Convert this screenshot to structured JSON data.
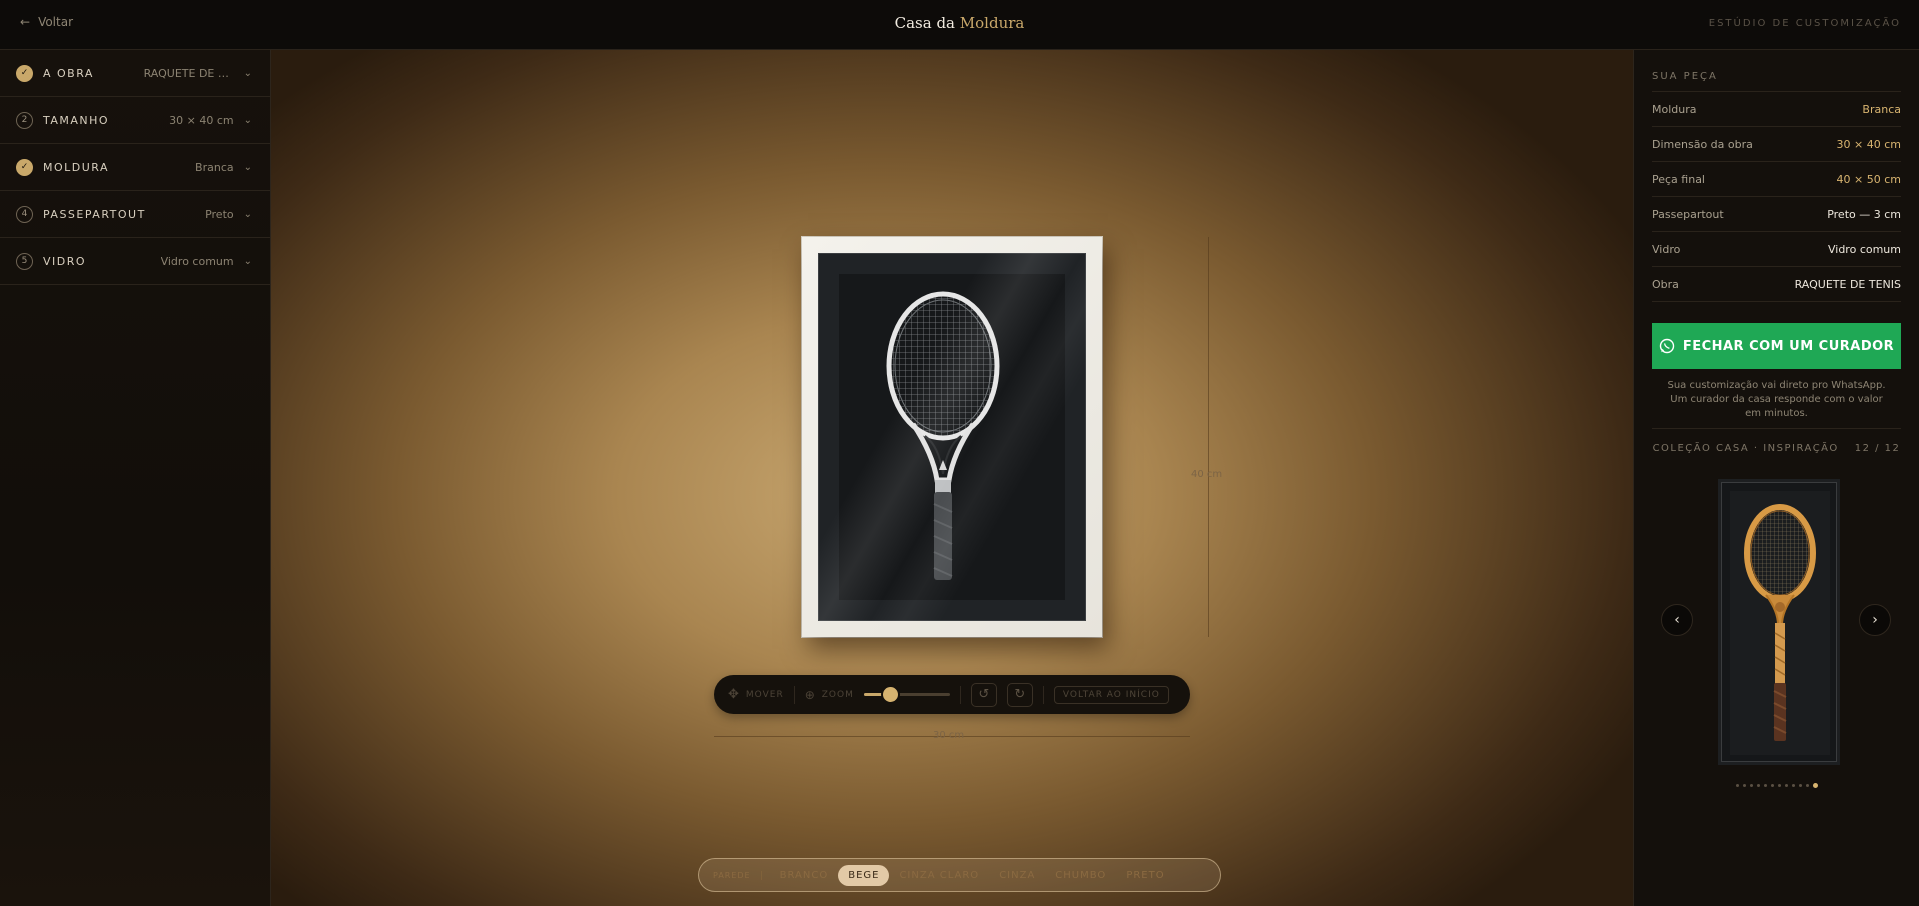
{
  "header": {
    "back_label": "Voltar",
    "brand_primary": "Casa da",
    "brand_accent": "Moldura",
    "studio_label": "ESTÚDIO DE CUSTOMIZAÇÃO"
  },
  "steps": [
    {
      "number": "✓",
      "done": true,
      "title": "A OBRA",
      "value": "RAQUETE DE TE..."
    },
    {
      "number": "2",
      "done": false,
      "title": "TAMANHO",
      "value": "30 × 40 cm"
    },
    {
      "number": "✓",
      "done": true,
      "title": "MOLDURA",
      "value": "Branca"
    },
    {
      "number": "4",
      "done": false,
      "title": "PASSEPARTOUT",
      "value": "Preto"
    },
    {
      "number": "5",
      "done": false,
      "title": "VIDRO",
      "value": "Vidro comum"
    }
  ],
  "stage": {
    "height_label": "40 cm",
    "width_label": "30 cm",
    "toolbar": {
      "move_label": "MOVER",
      "zoom_label": "ZOOM",
      "zoom_level": 0.3,
      "reset_label": "VOLTAR AO INÍCIO"
    },
    "wall": {
      "label": "PAREDE",
      "options": [
        "BRANCO",
        "BEGE",
        "CINZA CLARO",
        "CINZA",
        "CHUMBO",
        "PRETO"
      ],
      "selected": "BEGE"
    }
  },
  "summary": {
    "title": "SUA PEÇA",
    "rows": [
      {
        "key": "Moldura",
        "value": "Branca",
        "gold": true
      },
      {
        "key": "Dimensão da obra",
        "value": "30 × 40 cm",
        "gold": true
      },
      {
        "key": "Peça final",
        "value": "40 × 50 cm",
        "gold": true
      },
      {
        "key": "Passepartout",
        "value": "Preto — 3 cm",
        "gold": false
      },
      {
        "key": "Vidro",
        "value": "Vidro comum",
        "gold": false
      },
      {
        "key": "Obra",
        "value": "RAQUETE DE TENIS",
        "gold": false
      }
    ],
    "cta_label": "FECHAR COM UM CURADOR",
    "cta_note": "Sua customização vai direto pro WhatsApp. Um curador da casa responde com o valor em minutos."
  },
  "collection": {
    "title": "COLEÇÃO CASA · INSPIRAÇÃO",
    "counter": "12 / 12",
    "current": 12,
    "total": 12,
    "prev_glyph": "‹",
    "next_glyph": "›"
  },
  "colors": {
    "accent_gold": "#c9a86a",
    "whatsapp_green": "#1fa855",
    "frame_white": "#f4f2ec",
    "mat_black": "#202326"
  }
}
